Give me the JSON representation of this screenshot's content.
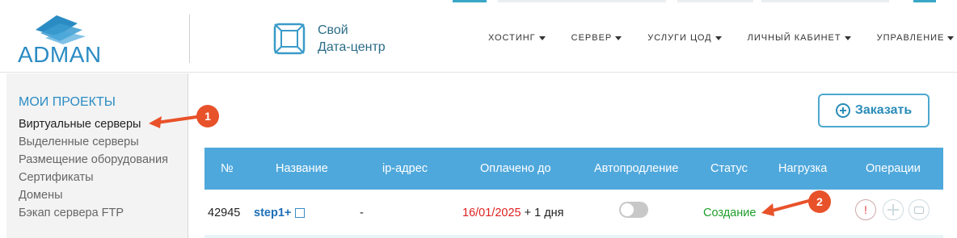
{
  "logo": {
    "text": "ADMAN"
  },
  "datacenter": {
    "line1": "Свой",
    "line2": "Дата-центр"
  },
  "nav": [
    {
      "label": "ХОСТИНГ"
    },
    {
      "label": "СЕРВЕР"
    },
    {
      "label": "УСЛУГИ ЦОД"
    },
    {
      "label": "ЛИЧНЫЙ КАБИНЕТ"
    },
    {
      "label": "УПРАВЛЕНИЕ"
    }
  ],
  "sidebar": {
    "title": "МОИ ПРОЕКТЫ",
    "items": [
      {
        "label": "Виртуальные серверы"
      },
      {
        "label": "Выделенные серверы"
      },
      {
        "label": "Размещение оборудования"
      },
      {
        "label": "Сертификаты"
      },
      {
        "label": "Домены"
      },
      {
        "label": "Бэкап сервера FTP"
      }
    ]
  },
  "order_button": {
    "label": "Заказать"
  },
  "table": {
    "headers": [
      "№",
      "Название",
      "ip-адрес",
      "Оплачено до",
      "Автопродление",
      "Статус",
      "Нагрузка",
      "Операции"
    ],
    "rows": [
      {
        "id": "42945",
        "name": "step1+",
        "ip": "-",
        "paid_until": "16/01/2025",
        "paid_extra": "+ 1 дня",
        "autorenew": false,
        "status": "Создание"
      }
    ]
  },
  "annotations": [
    {
      "label": "1"
    },
    {
      "label": "2"
    }
  ],
  "colors": {
    "accent": "#4fa8dc",
    "status_ok": "#1e9e2a",
    "date_red": "#e02020",
    "marker": "#e8522a"
  }
}
